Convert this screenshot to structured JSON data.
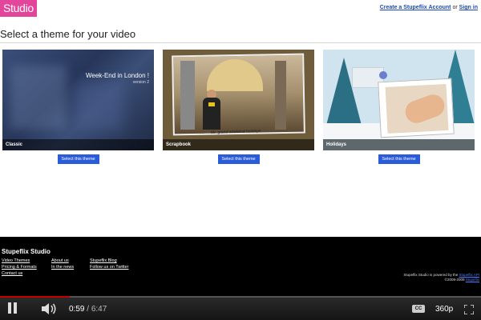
{
  "header": {
    "logo": "Studio",
    "create_account": "Create a Stupeflix Account",
    "or": "or",
    "sign_in": "Sign in",
    "page_title": "Select a theme for your video"
  },
  "themes": [
    {
      "name": "Classic",
      "button": "Select this theme",
      "overlay_title": "Week-End in London !",
      "overlay_sub": "version 2"
    },
    {
      "name": "Scrapbook",
      "button": "Select this theme",
      "overlay_note": "Mr. grand weekend holidays"
    },
    {
      "name": "Holidays",
      "button": "Select this theme"
    }
  ],
  "footer": {
    "brand": "Stupeflix Studio",
    "col1": [
      "Video Themes",
      "Pricing & Formats",
      "Contact us"
    ],
    "col2": [
      "About us",
      "In the news"
    ],
    "col3": [
      "Stupeflix Blog",
      "Follow us on Twitter"
    ],
    "powered_line1": "Stupeflix Studio is powered by the",
    "powered_link": "Stupeflix API",
    "powered_line2": "©2008-2009",
    "powered_link2": "Stupeflix"
  },
  "player": {
    "current_time": "0:59",
    "separator": "/",
    "duration": "6:47",
    "progress_fraction": 0.145,
    "cc_label": "CC",
    "quality": "360p",
    "accent_color": "#c40000"
  }
}
